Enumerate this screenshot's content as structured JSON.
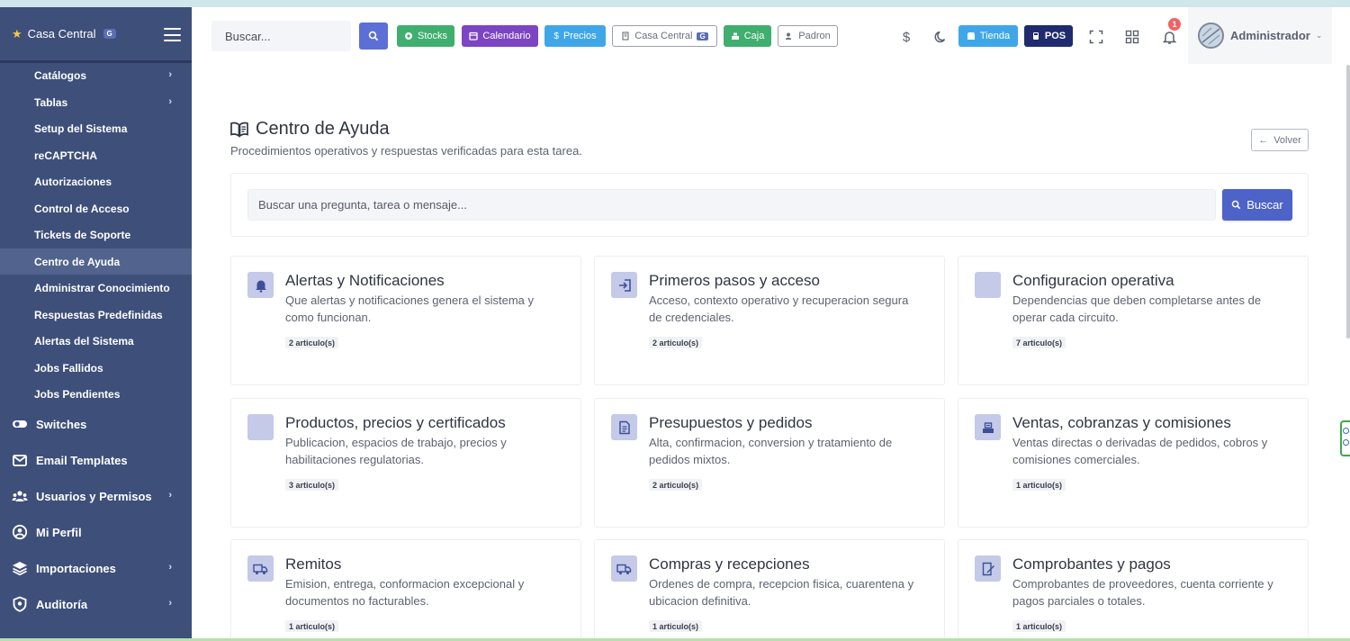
{
  "sidebar": {
    "brand": "Casa Central",
    "brand_badge": "G",
    "sub_items": [
      {
        "label": "Catálogos",
        "chevron": true
      },
      {
        "label": "Tablas",
        "chevron": true
      },
      {
        "label": "Setup del Sistema"
      },
      {
        "label": "reCAPTCHA"
      },
      {
        "label": "Autorizaciones"
      },
      {
        "label": "Control de Acceso"
      },
      {
        "label": "Tickets de Soporte"
      },
      {
        "label": "Centro de Ayuda",
        "active": true
      },
      {
        "label": "Administrar Conocimiento"
      },
      {
        "label": "Respuestas Predefinidas"
      },
      {
        "label": "Alertas del Sistema"
      },
      {
        "label": "Jobs Fallidos"
      },
      {
        "label": "Jobs Pendientes"
      }
    ],
    "main_items": [
      {
        "label": "Switches",
        "icon": "toggle-icon"
      },
      {
        "label": "Email Templates",
        "icon": "email-icon"
      },
      {
        "label": "Usuarios y Permisos",
        "icon": "users-icon",
        "chevron": true
      },
      {
        "label": "Mi Perfil",
        "icon": "profile-icon"
      },
      {
        "label": "Importaciones",
        "icon": "layers-icon",
        "chevron": true
      },
      {
        "label": "Auditoría",
        "icon": "shield-icon",
        "chevron": true
      }
    ]
  },
  "topbar": {
    "search_placeholder": "Buscar...",
    "buttons": {
      "stocks": "Stocks",
      "calendario": "Calendario",
      "precios": "Precios",
      "casa_central": "Casa Central",
      "casa_central_badge": "G",
      "caja": "Caja",
      "padron": "Padron",
      "tienda": "Tienda",
      "pos": "POS"
    },
    "notifications_count": "1",
    "user_name": "Administrador"
  },
  "colors": {
    "sidebar_bg": "#3e4f7a",
    "stocks": "#3fae6f",
    "calendario": "#7d45c4",
    "precios": "#3fa7e8",
    "caja": "#3fae6f",
    "tienda": "#3fa7e8",
    "pos": "#1f2b6e",
    "primary": "#4e63c8"
  },
  "page": {
    "title": "Centro de Ayuda",
    "subtitle": "Procedimientos operativos y respuestas verificadas para esta tarea.",
    "back_label": "Volver",
    "search_placeholder": "Buscar una pregunta, tarea o mensaje...",
    "search_button": "Buscar"
  },
  "categories": [
    {
      "title": "Alertas y Notificaciones",
      "desc": "Que alertas y notificaciones genera el sistema y como funcionan.",
      "count": "2 articulo(s)",
      "icon": "bell-icon"
    },
    {
      "title": "Primeros pasos y acceso",
      "desc": "Acceso, contexto operativo y recuperacion segura de credenciales.",
      "count": "2 articulo(s)",
      "icon": "login-icon"
    },
    {
      "title": "Configuracion operativa",
      "desc": "Dependencias que deben completarse antes de operar cada circuito.",
      "count": "7 articulo(s)",
      "icon": "blank-icon"
    },
    {
      "title": "Productos, precios y certificados",
      "desc": "Publicacion, espacios de trabajo, precios y habilitaciones regulatorias.",
      "count": "3 articulo(s)",
      "icon": "blank-icon"
    },
    {
      "title": "Presupuestos y pedidos",
      "desc": "Alta, confirmacion, conversion y tratamiento de pedidos mixtos.",
      "count": "2 articulo(s)",
      "icon": "document-icon"
    },
    {
      "title": "Ventas, cobranzas y comisiones",
      "desc": "Ventas directas o derivadas de pedidos, cobros y comisiones comerciales.",
      "count": "1 articulo(s)",
      "icon": "register-icon"
    },
    {
      "title": "Remitos",
      "desc": "Emision, entrega, conformacion excepcional y documentos no facturables.",
      "count": "1 articulo(s)",
      "icon": "truck-icon"
    },
    {
      "title": "Compras y recepciones",
      "desc": "Ordenes de compra, recepcion fisica, cuarentena y ubicacion definitiva.",
      "count": "1 articulo(s)",
      "icon": "truck-icon"
    },
    {
      "title": "Comprobantes y pagos",
      "desc": "Comprobantes de proveedores, cuenta corriente y pagos parciales o totales.",
      "count": "1 articulo(s)",
      "icon": "receipt-edit-icon"
    }
  ]
}
